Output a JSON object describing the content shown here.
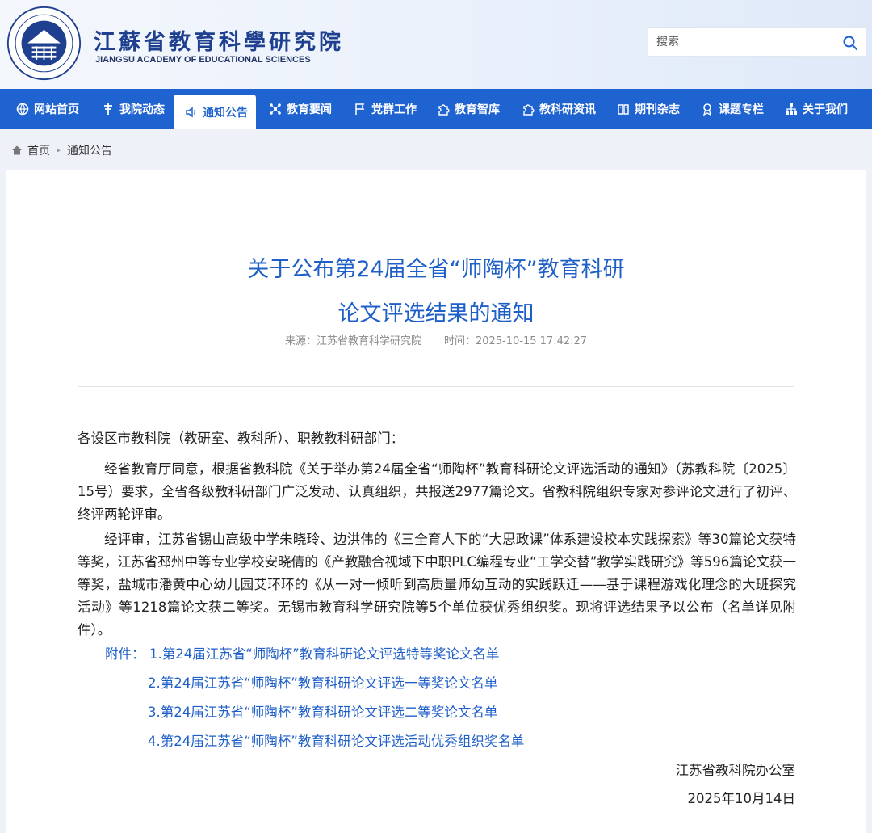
{
  "header": {
    "name_cn": "江蘇省教育科學研究院",
    "name_en": "JIANGSU ACADEMY OF EDUCATIONAL SCIENCES",
    "search_placeholder": "搜索"
  },
  "nav": [
    {
      "label": "网站首页",
      "icon": "globe-icon"
    },
    {
      "label": "我院动态",
      "icon": "flag-pole-icon"
    },
    {
      "label": "通知公告",
      "icon": "speaker-icon",
      "active": true
    },
    {
      "label": "教育要闻",
      "icon": "network-icon"
    },
    {
      "label": "党群工作",
      "icon": "flag-icon"
    },
    {
      "label": "教育智库",
      "icon": "puzzle-icon"
    },
    {
      "label": "教科研资讯",
      "icon": "puzzle-icon"
    },
    {
      "label": "期刊杂志",
      "icon": "book-icon"
    },
    {
      "label": "课题专栏",
      "icon": "award-icon"
    },
    {
      "label": "关于我们",
      "icon": "org-chart-icon"
    }
  ],
  "breadcrumb": {
    "home": "首页",
    "current": "通知公告"
  },
  "article": {
    "title_line1": "关于公布第24届全省“师陶杯”教育科研",
    "title_line2": "论文评选结果的通知",
    "source": "来源：江苏省教育科学研究院",
    "time": "时间：2025-10-15 17:42:27",
    "greeting": "各设区市教科院（教研室、教科所）、职教教科研部门：",
    "para1": "经省教育厅同意，根据省教科院《关于举办第24届全省“师陶杯”教育科研论文评选活动的通知》（苏教科院〔2025〕15号）要求，全省各级教科研部门广泛发动、认真组织，共报送2977篇论文。省教科院组织专家对参评论文进行了初评、终评两轮评审。",
    "para2": "经评审，江苏省锡山高级中学朱晓玲、边洪伟的《三全育人下的“大思政课”体系建设校本实践探索》等30篇论文获特等奖，江苏省邳州中等专业学校安晓倩的《产教融合视域下中职PLC编程专业“工学交替”教学实践研究》等596篇论文获一等奖，盐城市潘黄中心幼儿园艾环环的《从一对一倾听到高质量师幼互动的实践跃迁——基于课程游戏化理念的大班探究活动》等1218篇论文获二等奖。无锡市教育科学研究院等5个单位获优秀组织奖。现将评选结果予以公布（名单详见附件）。",
    "attachments_label": "附件：",
    "attachments": [
      "1.第24届江苏省“师陶杯”教育科研论文评选特等奖论文名单",
      "2.第24届江苏省“师陶杯”教育科研论文评选一等奖论文名单",
      "3.第24届江苏省“师陶杯”教育科研论文评选二等奖论文名单",
      "4.第24届江苏省“师陶杯”教育科研论文评选活动优秀组织奖名单"
    ],
    "signer": "江苏省教科院办公室",
    "date": "2025年10月14日"
  },
  "colors": {
    "primary": "#1f63d1",
    "link": "#1f5fc8",
    "background": "#eef2f8"
  }
}
